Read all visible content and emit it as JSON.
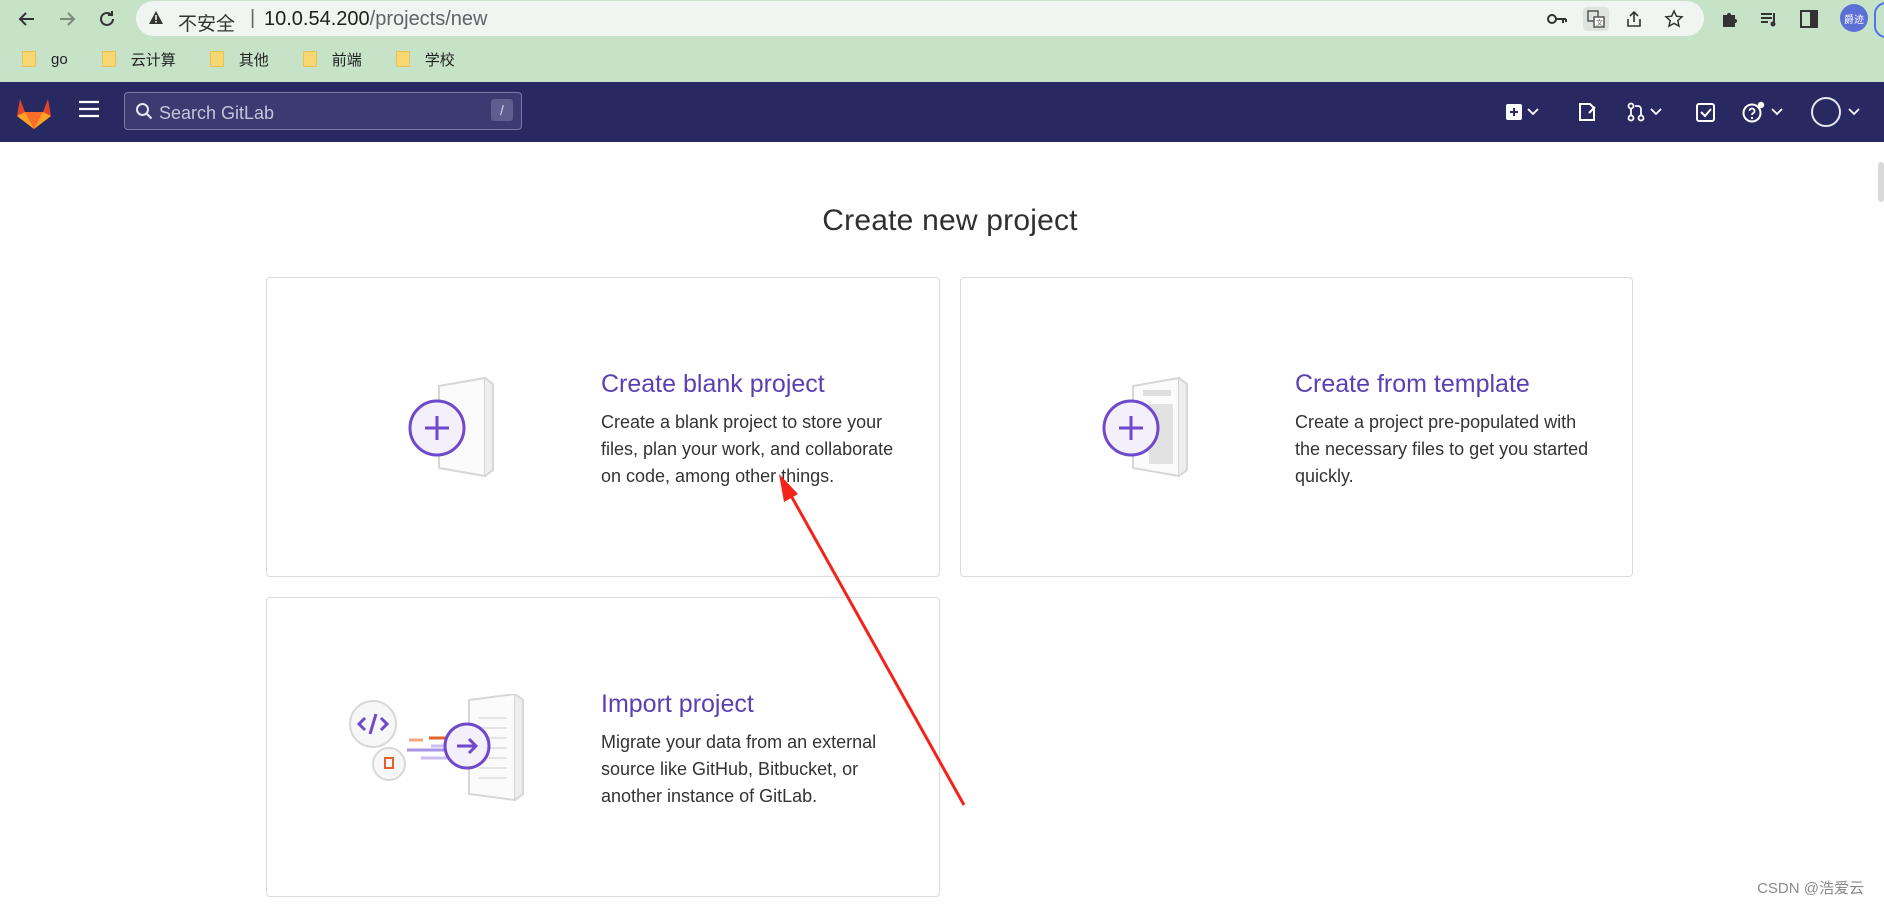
{
  "browser": {
    "security_label": "不安全",
    "separator": "|",
    "url_host": "10.0.54.200",
    "url_path": "/projects/new",
    "profile_badge": "爵迹",
    "bookmarks": [
      {
        "label": "go"
      },
      {
        "label": "云计算"
      },
      {
        "label": "其他"
      },
      {
        "label": "前端"
      },
      {
        "label": "学校"
      }
    ]
  },
  "header": {
    "search_placeholder": "Search GitLab",
    "search_shortcut": "/",
    "brand_color": "#292961"
  },
  "page": {
    "title": "Create new project",
    "cards": [
      {
        "title": "Create blank project",
        "description": "Create a blank project to store your files, plan your work, and collaborate on code, among other things."
      },
      {
        "title": "Create from template",
        "description": "Create a project pre-populated with the necessary files to get you started quickly."
      },
      {
        "title": "Import project",
        "description": "Migrate your data from an external source like GitHub, Bitbucket, or another instance of GitLab."
      }
    ],
    "accent_color": "#5b3fb5"
  },
  "watermark": "CSDN @浩爱云"
}
